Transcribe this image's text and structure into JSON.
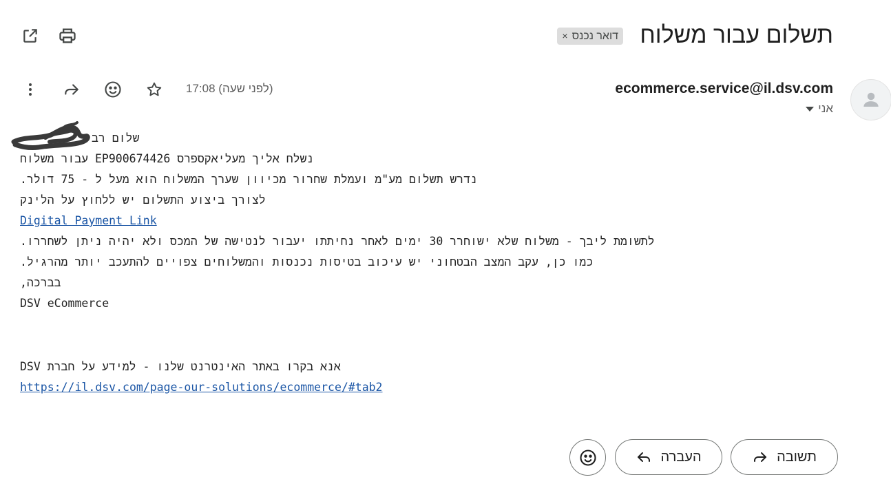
{
  "toolbar": {
    "icons": [
      "open-in-new-window-icon",
      "print-icon"
    ]
  },
  "subject": {
    "title": "תשלום עבור משלוח",
    "label_chip": "דואר נכנס",
    "label_close": "×"
  },
  "message_header": {
    "sender_email": "ecommerce.service@il.dsv.com",
    "recipient": "אני",
    "timestamp": "17:08 (לפני שעה)",
    "actions": [
      "star-icon",
      "emoji-reaction-icon",
      "reply-icon",
      "more-options-icon"
    ]
  },
  "body": {
    "greeting": "שלום רב",
    "line1": "נשלח אליך מעליאקספרס EP900674426 עבור משלוח",
    "line2": "נדרש תשלום מע\"מ ועמלת שחרור מכיוון שערך המשלוח הוא מעל ל - 75 דולר.",
    "line3": "לצורך ביצוע התשלום יש ללחוץ על הלינק",
    "payment_link": "Digital Payment Link",
    "line4": "לתשומת ליבך - משלוח שלא ישוחרר 30 ימים לאחר נחיתתו יעבור לנטישה של המכס ולא יהיה ניתן לשחררו.",
    "line5": "כמו כן, עקב המצב הבטחוני יש עיכוב בטיסות נכנסות והמשלוחים צפויים להתעכב יותר מהרגיל.",
    "closing": "בברכה,",
    "signature": "DSV eCommerce",
    "info_line": "אנא בקרו באתר האינטרנט שלנו - למידע על חברת DSV",
    "website_link": "https://il.dsv.com/page-our-solutions/ecommerce/#tab2"
  },
  "reply_bar": {
    "reply_label": "תשובה",
    "forward_label": "העברה"
  }
}
